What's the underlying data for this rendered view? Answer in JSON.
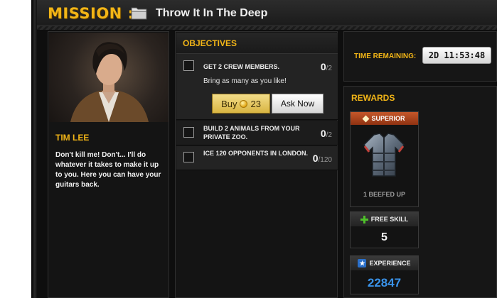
{
  "header": {
    "mission_label": "MISSION :",
    "mission_name": "Throw It In The Deep",
    "icon": "folder-icon"
  },
  "character": {
    "name": "TIM LEE",
    "quote": "Don't kill me! Don't... I'll do whatever it takes to make it up to you. Here you can have your guitars back."
  },
  "objectives": {
    "title": "OBJECTIVES",
    "items": [
      {
        "text": "GET 2 CREW MEMBERS.",
        "done": "0",
        "total": "/2",
        "hint": "Bring as many as you like!",
        "buy_label": "Buy",
        "buy_cost": "23",
        "ask_label": "Ask Now"
      },
      {
        "text": "BUILD 2 ANIMALS FROM YOUR PRIVATE ZOO.",
        "done": "0",
        "total": "/2"
      },
      {
        "text": "ICE 120 OPPONENTS IN LONDON.",
        "done": "0",
        "total": "/120"
      }
    ]
  },
  "timer": {
    "label": "TIME REMAINING:",
    "value": "2D 11:53:48"
  },
  "rewards": {
    "title": "REWARDS",
    "item": {
      "rarity": "SUPERIOR",
      "name": "1 BEEFED UP",
      "icon": "shirt-icon"
    },
    "free_skill": {
      "label": "FREE SKILL",
      "value": "5",
      "icon": "plus-icon"
    },
    "experience": {
      "label": "EXPERIENCE",
      "value": "22847",
      "icon": "star-icon"
    }
  },
  "colors": {
    "accent": "#f2b517",
    "background": "#141414",
    "experience": "#3a93ea",
    "superior": "#c4572a"
  }
}
